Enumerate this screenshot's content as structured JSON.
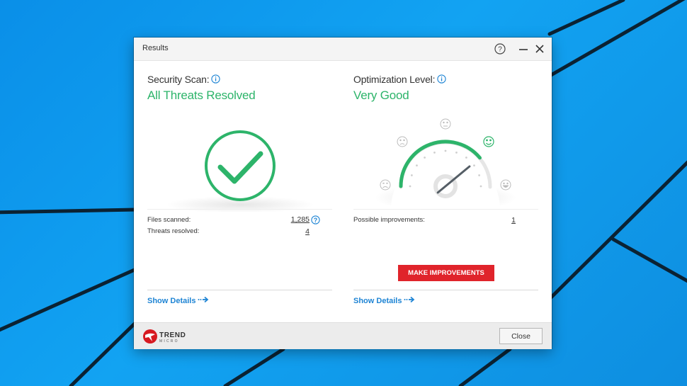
{
  "window": {
    "title": "Results"
  },
  "security": {
    "label": "Security Scan:",
    "status": "All Threats Resolved",
    "stats": [
      {
        "label": "Files scanned:",
        "value": "1,285"
      },
      {
        "label": "Threats resolved:",
        "value": "4"
      }
    ],
    "show_details": "Show Details"
  },
  "optimization": {
    "label": "Optimization Level:",
    "status": "Very Good",
    "stats": [
      {
        "label": "Possible improvements:",
        "value": "1"
      }
    ],
    "make_improvements": "MAKE IMPROVEMENTS",
    "show_details": "Show Details",
    "gauge_level": 0.78
  },
  "footer": {
    "brand_name": "TREND",
    "brand_sub": "MICRO",
    "close_label": "Close"
  },
  "colors": {
    "accent_green": "#2db46a",
    "link_blue": "#1e84d4",
    "action_red": "#e0242b",
    "brand_red": "#d71920"
  },
  "icons": [
    "help-icon",
    "minimize-icon",
    "close-icon",
    "info-icon",
    "checkmark-icon",
    "gauge-icon",
    "trend-micro-logo"
  ]
}
